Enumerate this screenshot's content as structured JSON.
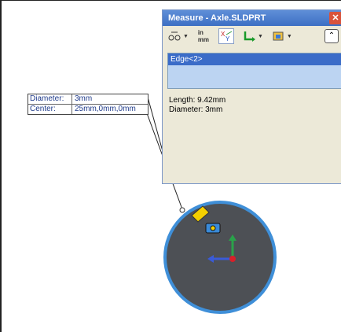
{
  "dialog": {
    "title": "Measure - Axle.SLDPRT",
    "close_label": "✕",
    "toolbar": {
      "arc_options_icon": "arc-circle-options-icon",
      "units_label": "in\nmm",
      "xyz_icon": "show-xyz-measurements-icon",
      "point_to_point_icon": "point-to-point-icon",
      "projected_icon": "projection-icon",
      "collapse_label": "⌃"
    },
    "selection": {
      "item": "Edge<2>"
    },
    "results": {
      "length": "Length: 9.42mm",
      "diameter": "Diameter: 3mm"
    }
  },
  "callout": {
    "rows": [
      {
        "label": "Diameter:",
        "value": "3mm"
      },
      {
        "label": "Center:",
        "value": "25mm,0mm,0mm"
      }
    ]
  },
  "colors": {
    "titlebar": "#3d6fc4",
    "selection_item": "#3b6cc8",
    "part_face": "#4d5055",
    "edge_highlight": "#3f8fd8"
  }
}
